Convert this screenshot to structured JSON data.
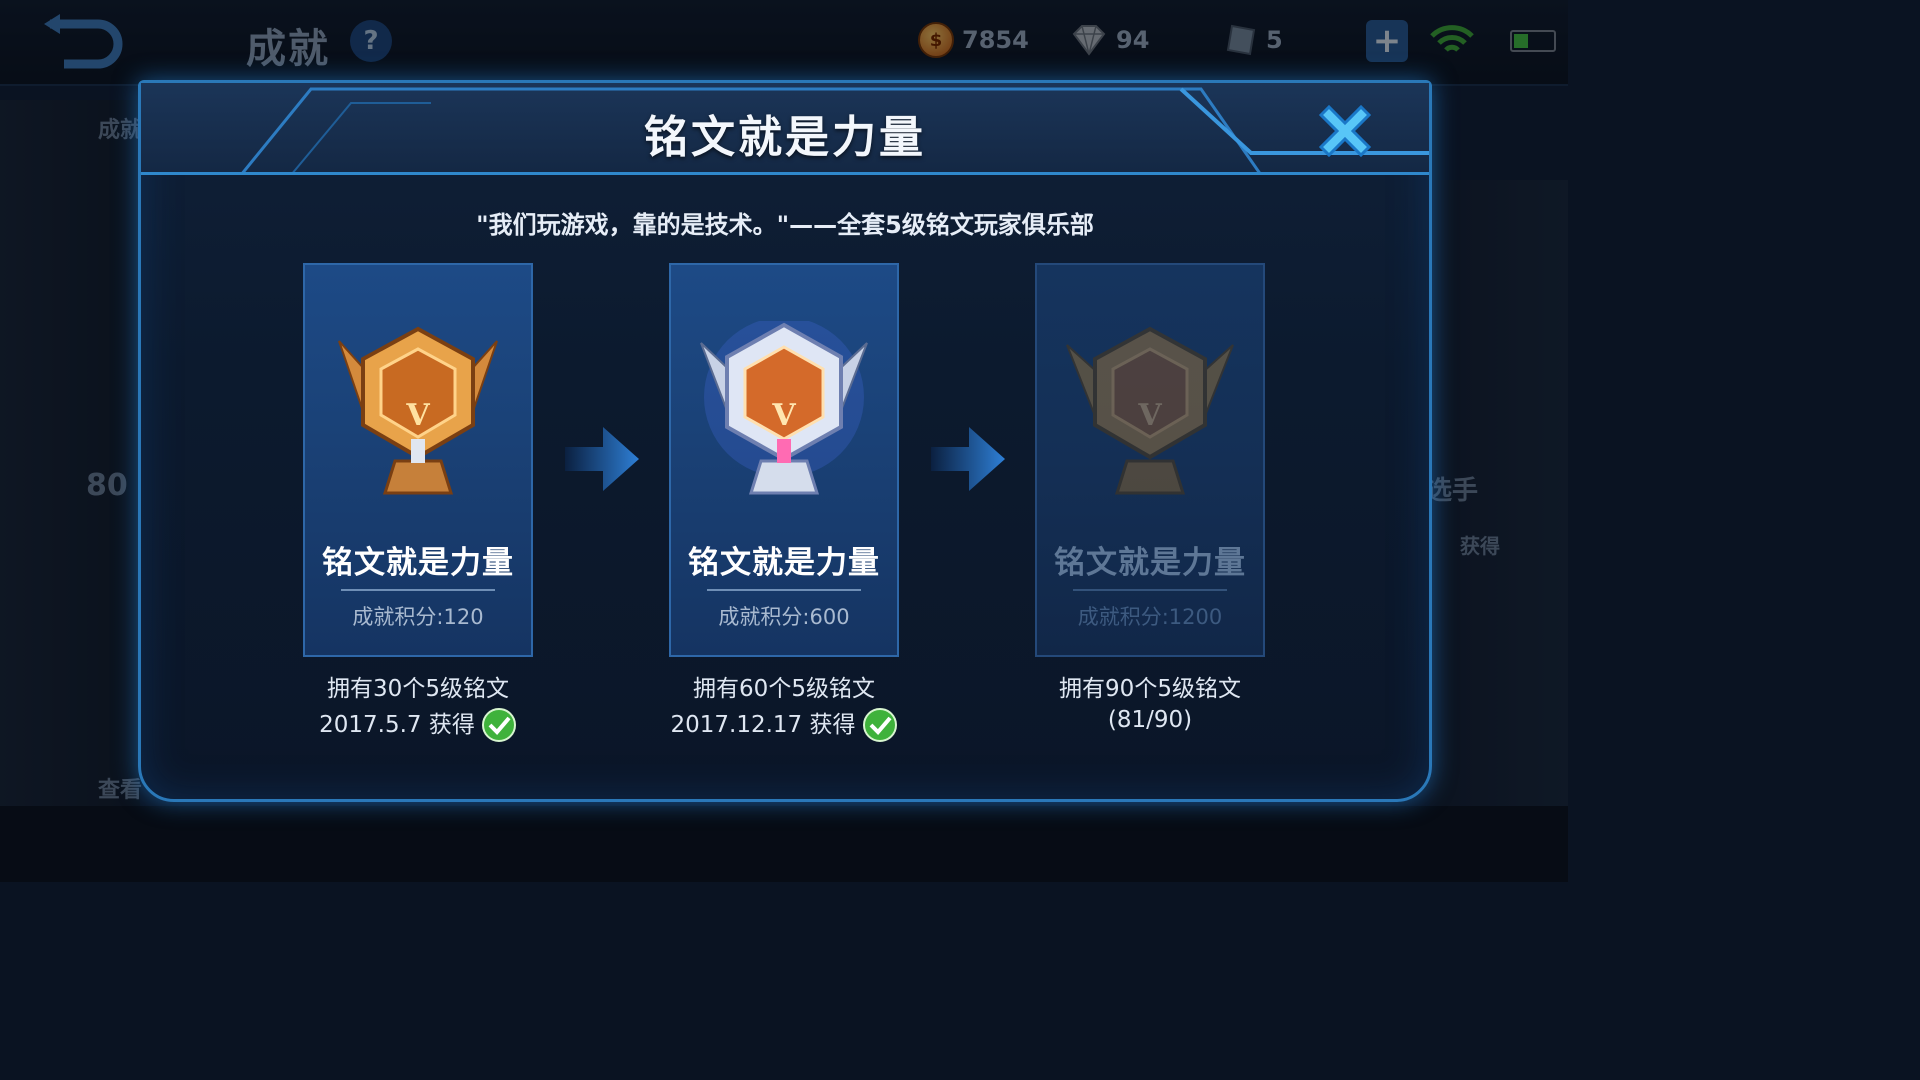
{
  "topbar": {
    "title": "成就",
    "help_label": "?",
    "gold": "7854",
    "gems": "94",
    "tickets": "5",
    "add_label": "+"
  },
  "background": {
    "left_tab": "成就",
    "left_score": "80",
    "left_button": "查看",
    "right_label": "选手",
    "right_sub": "获得"
  },
  "modal": {
    "title": "铭文就是力量",
    "quote": "\"我们玩游戏，靠的是技术。\"——全套5级铭文玩家俱乐部",
    "cards": [
      {
        "name": "铭文就是力量",
        "score": "成就积分:120",
        "requirement": "拥有30个5级铭文",
        "status": "2017.5.7 获得",
        "tier": "bronze",
        "unlocked": true
      },
      {
        "name": "铭文就是力量",
        "score": "成就积分:600",
        "requirement": "拥有60个5级铭文",
        "status": "2017.12.17 获得",
        "tier": "silver",
        "unlocked": true
      },
      {
        "name": "铭文就是力量",
        "score": "成就积分:1200",
        "requirement": "拥有90个5级铭文",
        "status": "(81/90)",
        "tier": "gold",
        "unlocked": false
      }
    ]
  },
  "colors": {
    "accent": "#2a78b8",
    "check": "#3fb23b",
    "arrow": "#2e7fd6"
  }
}
